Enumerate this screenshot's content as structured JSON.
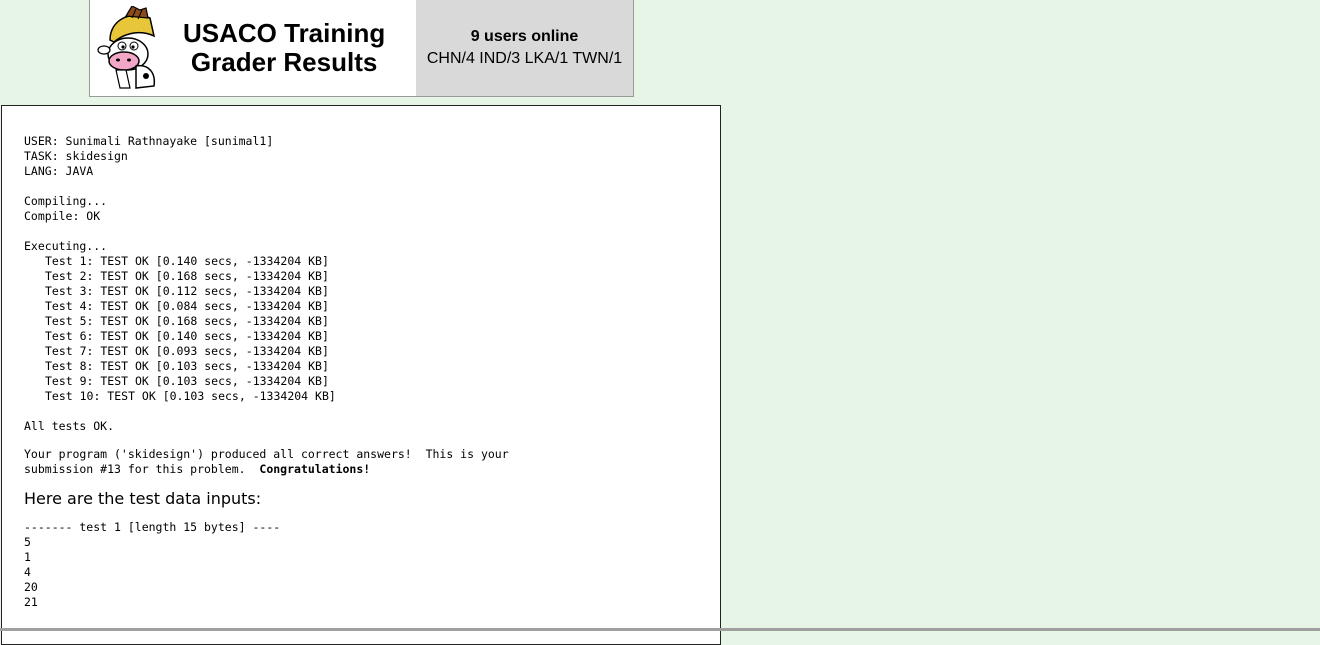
{
  "header": {
    "title_line1": "USACO Training",
    "title_line2": "Grader Results",
    "users_online": "9 users online",
    "user_countries": "CHN/4 IND/3 LKA/1 TWN/1",
    "logo_icon": "cow-knight-logo"
  },
  "submission": {
    "user_line": "USER: Sunimali Rathnayake [sunimal1]",
    "task_line": "TASK: skidesign",
    "lang_line": "LANG: JAVA",
    "compiling": "Compiling...",
    "compile_result": "Compile: OK",
    "executing": "Executing...",
    "tests": [
      "Test 1: TEST OK [0.140 secs, -1334204 KB]",
      "Test 2: TEST OK [0.168 secs, -1334204 KB]",
      "Test 3: TEST OK [0.112 secs, -1334204 KB]",
      "Test 4: TEST OK [0.084 secs, -1334204 KB]",
      "Test 5: TEST OK [0.168 secs, -1334204 KB]",
      "Test 6: TEST OK [0.140 secs, -1334204 KB]",
      "Test 7: TEST OK [0.093 secs, -1334204 KB]",
      "Test 8: TEST OK [0.103 secs, -1334204 KB]",
      "Test 9: TEST OK [0.103 secs, -1334204 KB]",
      "Test 10: TEST OK [0.103 secs, -1334204 KB]"
    ],
    "all_tests": "All tests OK.",
    "message_line1": "Your program ('skidesign') produced all correct answers!  This is your",
    "message_line2_prefix": "submission #13 for this problem.  ",
    "message_congrats": "Congratulations!"
  },
  "test_data": {
    "heading": "Here are the test data inputs:",
    "test1_header": "------- test 1 [length 15 bytes] ----",
    "test1_lines": [
      "5",
      "1",
      "4",
      "20",
      "21"
    ]
  },
  "colors": {
    "page_background": "#e6f5e6",
    "header_right_background": "#d9d9d9"
  }
}
